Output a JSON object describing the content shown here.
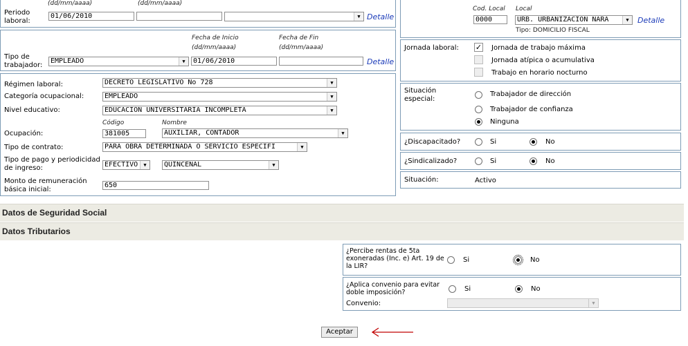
{
  "periodo": {
    "hint_top_1": "(dd/mm/aaaa)",
    "hint_top_2": "(dd/mm/aaaa)",
    "label": "Periodo laboral:",
    "start": "01/06/2010",
    "end": "",
    "reason": "",
    "detail": "Detalle"
  },
  "tipo_trab": {
    "hint_start": "Fecha de Inicio",
    "hint_end": "Fecha de Fin",
    "hint_fmt_1": "(dd/mm/aaaa)",
    "hint_fmt_2": "(dd/mm/aaaa)",
    "label": "Tipo de trabajador:",
    "value": "EMPLEADO",
    "start": "01/06/2010",
    "end": "",
    "detail": "Detalle"
  },
  "local": {
    "cod_label": "Cod. Local",
    "local_label": "Local",
    "cod_value": "0000",
    "local_value": "URB. URBANIZACION NARA",
    "tipo": "Tipo: DOMICILIO FISCAL",
    "detail": "Detalle"
  },
  "laboral": {
    "regimen_label": "Régimen laboral:",
    "regimen_value": "DECRETO LEGISLATIVO No 728",
    "categoria_label": "Categoría ocupacional:",
    "categoria_value": "EMPLEADO",
    "nivel_label": "Nivel educativo:",
    "nivel_value": "EDUCACION UNIVERSITARIA INCOMPLETA",
    "codigo_hint": "Código",
    "nombre_hint": "Nombre",
    "ocupacion_label": "Ocupación:",
    "ocupacion_codigo": "381005",
    "ocupacion_nombre": "AUXILIAR, CONTADOR",
    "contrato_label": "Tipo de contrato:",
    "contrato_value": "PARA OBRA DETERMINADA O SERVICIO ESPECIFI",
    "pago_label": "Tipo de pago y periodicidad de ingreso:",
    "pago_tipo": "EFECTIVO",
    "pago_periodo": "QUINCENAL",
    "monto_label": "Monto de remuneración básica inicial:",
    "monto_value": "650"
  },
  "jornada": {
    "label": "Jornada laboral:",
    "opt1": "Jornada de trabajo máxima",
    "opt2": "Jornada atípica o acumulativa",
    "opt3": "Trabajo en horario nocturno"
  },
  "situacion_especial": {
    "label": "Situación especial:",
    "opt1": "Trabajador de dirección",
    "opt2": "Trabajador de confianza",
    "opt3": "Ninguna"
  },
  "discapacitado": {
    "label": "¿Discapacitado?",
    "si": "Si",
    "no": "No"
  },
  "sindicalizado": {
    "label": "¿Sindicalizado?",
    "si": "Si",
    "no": "No"
  },
  "situacion": {
    "label": "Situación:",
    "value": "Activo"
  },
  "sections": {
    "seguridad": "Datos de Seguridad Social",
    "tributarios": "Datos Tributarios"
  },
  "tributarios": {
    "rentas_label": "¿Percibe rentas de 5ta exoneradas (Inc. e) Art. 19 de la LIR?",
    "rentas_si": "Si",
    "rentas_no": "No",
    "convenio_label": "¿Aplica convenio para evitar doble imposición?",
    "convenio_si": "Si",
    "convenio_no": "No",
    "convenio_select_label": "Convenio:",
    "convenio_value": ""
  },
  "aceptar": "Aceptar",
  "colors": {
    "border": "#7d9bb5",
    "link": "#1a3ab8",
    "band": "#ecebe3",
    "arrow": "#c00000"
  }
}
